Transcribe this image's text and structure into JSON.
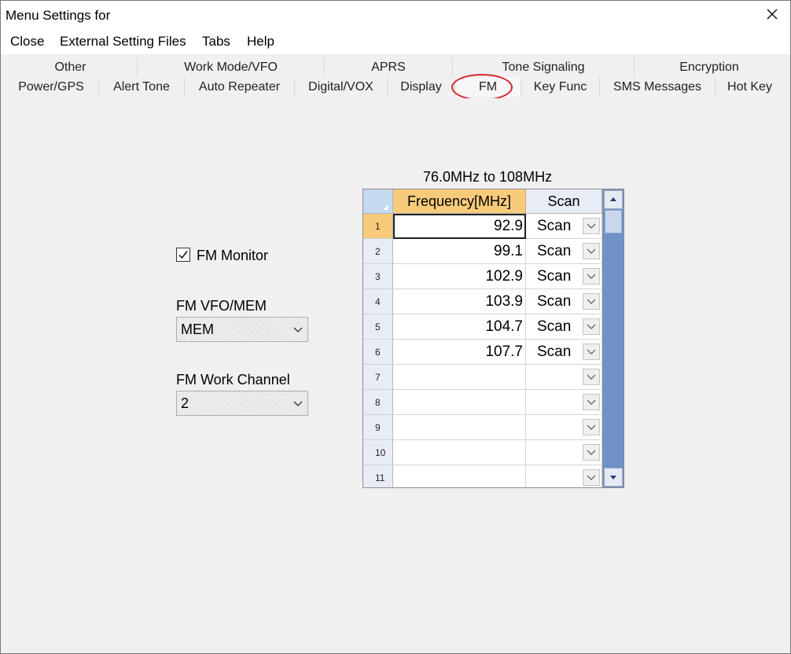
{
  "window": {
    "title": "Menu Settings for"
  },
  "menu": [
    "Close",
    "External Setting Files",
    "Tabs",
    "Help"
  ],
  "tabs": {
    "row1": [
      "Other",
      "Work Mode/VFO",
      "APRS",
      "Tone Signaling",
      "Encryption"
    ],
    "row2": [
      "Power/GPS",
      "Alert Tone",
      "Auto Repeater",
      "Digital/VOX",
      "Display",
      "FM",
      "Key Func",
      "SMS Messages",
      "Hot Key"
    ],
    "active": "FM"
  },
  "fm_monitor": {
    "label": "FM Monitor",
    "checked": true
  },
  "fm_vfo_mem": {
    "label": "FM VFO/MEM",
    "value": "MEM"
  },
  "fm_work_channel": {
    "label": "FM Work Channel",
    "value": "2"
  },
  "freq_table": {
    "range_label": "76.0MHz to 108MHz",
    "col_frequency": "Frequency[MHz]",
    "col_scan": "Scan",
    "rows": [
      {
        "num": "1",
        "freq": "92.9",
        "scan": "Scan"
      },
      {
        "num": "2",
        "freq": "99.1",
        "scan": "Scan"
      },
      {
        "num": "3",
        "freq": "102.9",
        "scan": "Scan"
      },
      {
        "num": "4",
        "freq": "103.9",
        "scan": "Scan"
      },
      {
        "num": "5",
        "freq": "104.7",
        "scan": "Scan"
      },
      {
        "num": "6",
        "freq": "107.7",
        "scan": "Scan"
      },
      {
        "num": "7",
        "freq": "",
        "scan": ""
      },
      {
        "num": "8",
        "freq": "",
        "scan": ""
      },
      {
        "num": "9",
        "freq": "",
        "scan": ""
      },
      {
        "num": "10",
        "freq": "",
        "scan": ""
      },
      {
        "num": "11",
        "freq": "",
        "scan": ""
      }
    ]
  },
  "colors": {
    "accent_header": "#f8cb7a",
    "scrollbar_track": "#6f92c7",
    "annotation_ring": "#d9202a"
  }
}
